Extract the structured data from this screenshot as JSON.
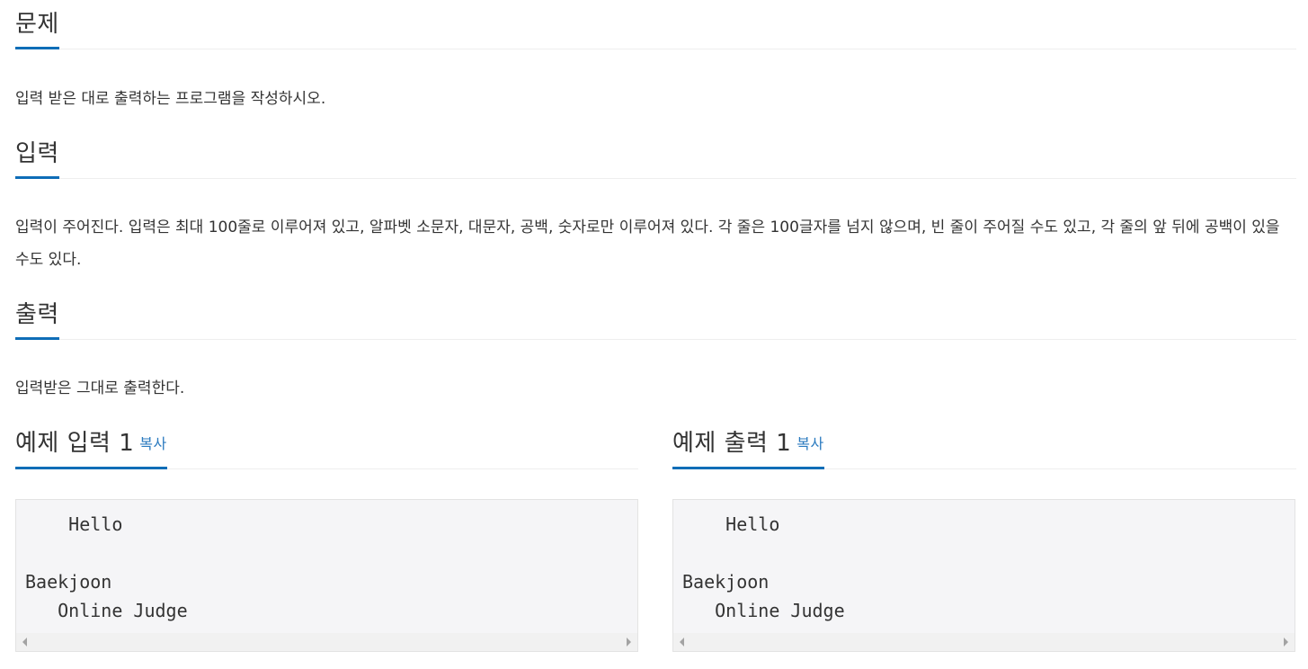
{
  "problem": {
    "title": "문제",
    "body": "입력 받은 대로 출력하는 프로그램을 작성하시오."
  },
  "input": {
    "title": "입력",
    "body": "입력이 주어진다. 입력은 최대 100줄로 이루어져 있고, 알파벳 소문자, 대문자, 공백, 숫자로만 이루어져 있다. 각 줄은 100글자를 넘지 않으며, 빈 줄이 주어질 수도 있고, 각 줄의 앞 뒤에 공백이 있을 수도 있다."
  },
  "output": {
    "title": "출력",
    "body": "입력받은 그대로 출력한다."
  },
  "sample_input": {
    "title": "예제 입력 1",
    "copy_label": "복사",
    "content": "    Hello\n\nBaekjoon\n   Online Judge"
  },
  "sample_output": {
    "title": "예제 출력 1",
    "copy_label": "복사",
    "content": "    Hello\n\nBaekjoon\n   Online Judge"
  },
  "colors": {
    "accent": "#0e6db7",
    "link": "#2a7abf",
    "pre_background": "#f5f5f7"
  },
  "icons": [
    "scroll-left-arrow-icon",
    "scroll-right-arrow-icon"
  ]
}
